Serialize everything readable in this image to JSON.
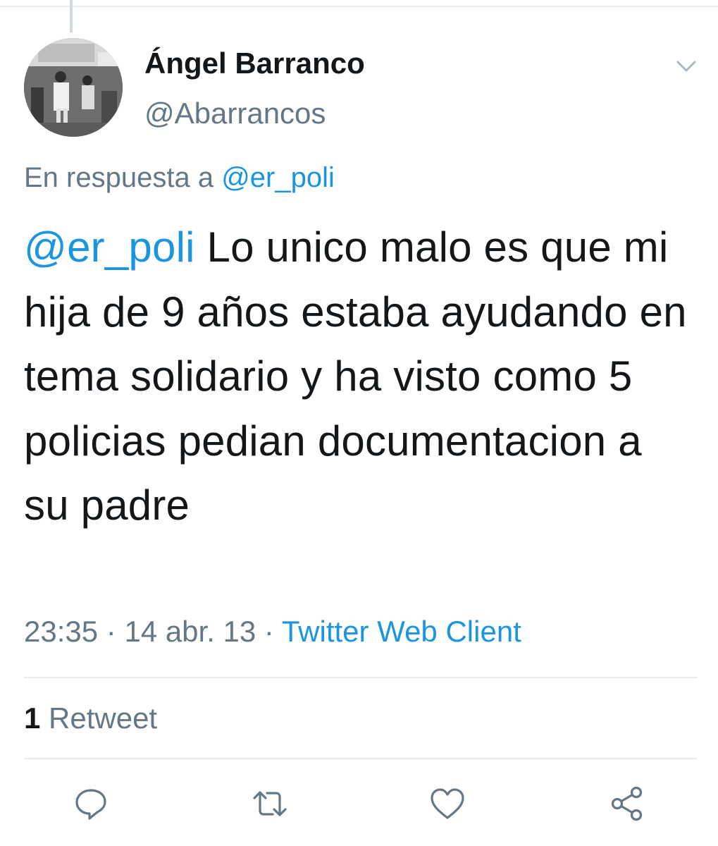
{
  "tweet": {
    "author_name": "Ángel Barranco",
    "author_handle": "@Abarrancos",
    "reply_prefix": "En respuesta a",
    "reply_to": "@er_poli",
    "body_mention": "@er_poli",
    "body_text": " Lo unico malo es que mi hija de 9 años estaba ayudando en tema solidario y ha visto como 5 policias pedian documentacion a su padre",
    "time": "23:35",
    "separator": " · ",
    "date": "14 abr. 13",
    "source": "Twitter Web Client"
  },
  "stats": {
    "retweet_count": "1",
    "retweet_label": " Retweet"
  },
  "icons": {
    "menu": "chevron-down-icon",
    "reply": "reply-icon",
    "retweet": "retweet-icon",
    "like": "heart-icon",
    "share": "share-icon"
  },
  "colors": {
    "link": "#1b95e0",
    "secondary_text": "#657786",
    "primary_text": "#14171a",
    "divider": "#e6ecf0"
  }
}
